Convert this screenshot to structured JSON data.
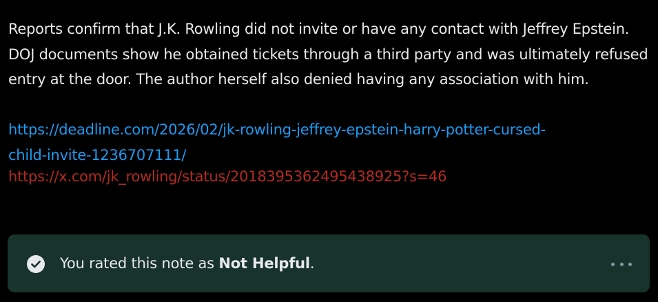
{
  "note": {
    "text": "Reports confirm that J.K. Rowling did not invite or have any contact with Jeffrey Epstein. DOJ documents show he obtained tickets through a third party and was ultimately refused entry at the door. The author herself also denied having any association with him.",
    "link_1_line_1": "https://deadline.com/2026/02/jk-rowling-jeffrey-epstein-harry-potter-cursed-",
    "link_1_line_2": "child-invite-1236707111/",
    "link_2": "https://x.com/jk_rowling/status/2018395362495438925?s=46"
  },
  "rating": {
    "prefix": "You rated this note as ",
    "value": "Not Helpful",
    "suffix": ".",
    "icon": "check-circle-icon",
    "more_icon": "more-dots-icon"
  },
  "colors": {
    "background": "#000000",
    "text": "#e7e9ea",
    "link_blue": "#1d9bf0",
    "link_red": "#b32a22",
    "rating_box": "#17332c"
  }
}
